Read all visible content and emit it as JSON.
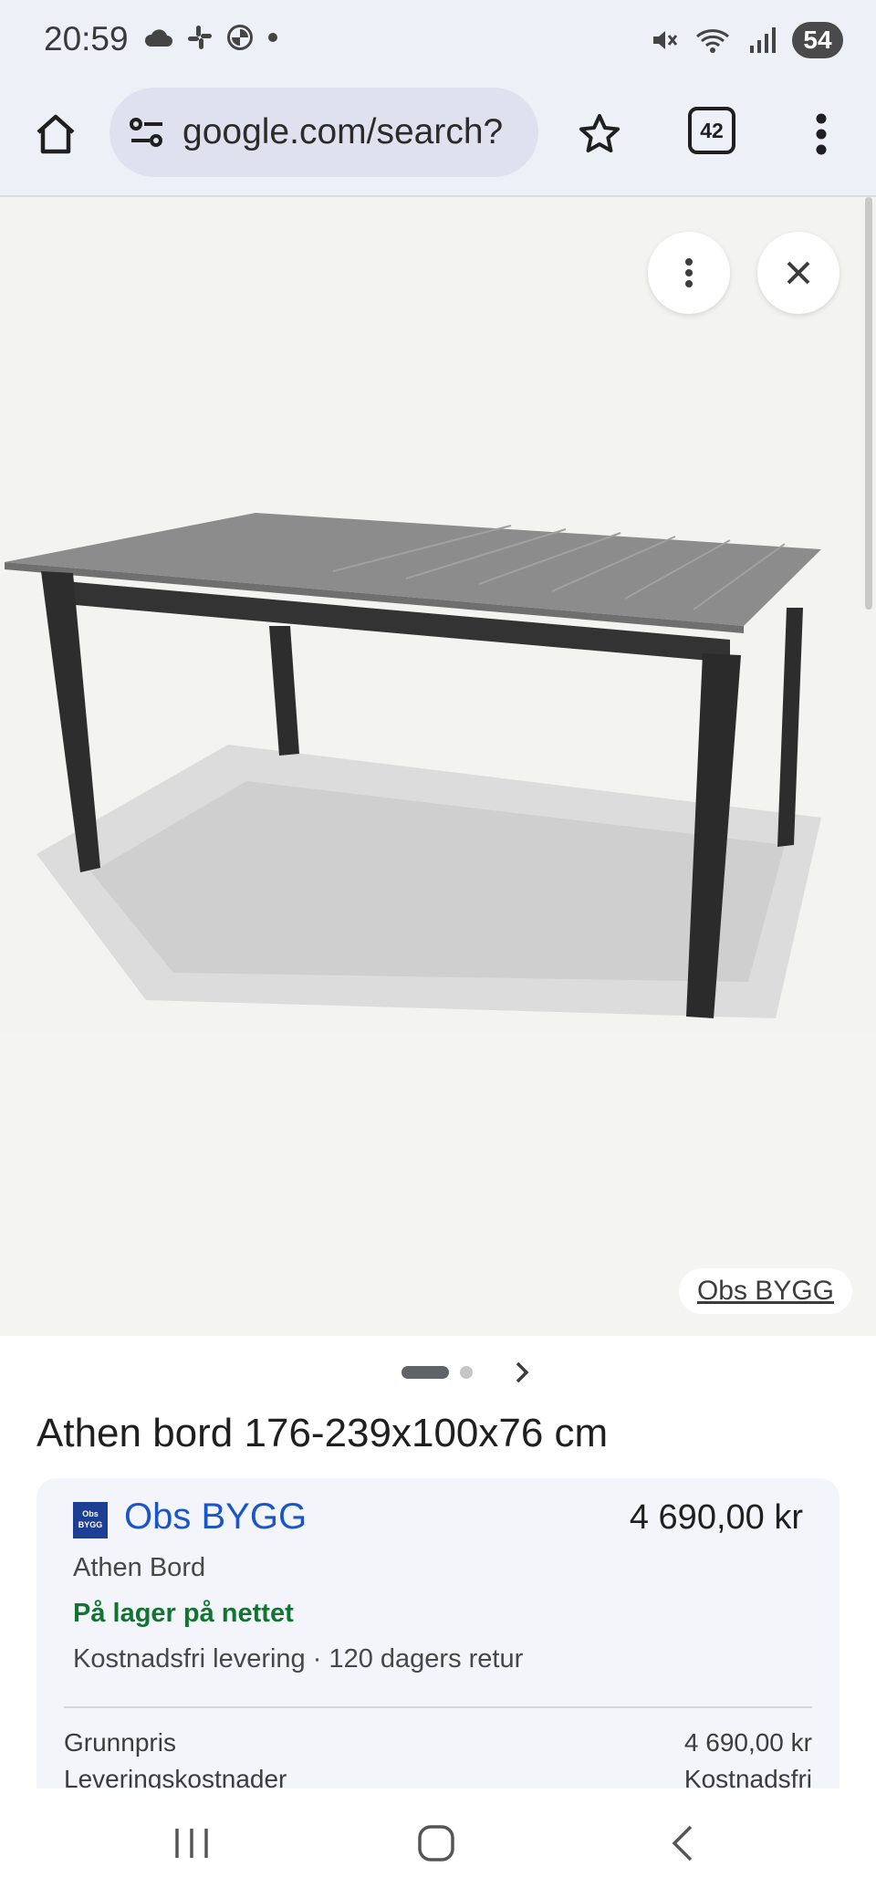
{
  "status_bar": {
    "time": "20:59",
    "battery": "54",
    "left_icons": [
      "cloud-icon",
      "slack-icon",
      "bmw-icon",
      "dot-icon"
    ],
    "right_icons": [
      "mute-icon",
      "wifi-icon",
      "signal-icon",
      "battery-icon"
    ]
  },
  "browser": {
    "url": "google.com/search?",
    "tab_count": "42",
    "icons": {
      "home": "home-icon",
      "site_settings": "tune-icon",
      "bookmark": "star-outline-icon",
      "menu": "more-vert-icon"
    }
  },
  "viewer": {
    "image_alt": "Athen bord",
    "source_label": "Obs BYGG",
    "pager": {
      "current": 1,
      "total": 2
    }
  },
  "product": {
    "title": "Athen bord 176-239x100x76 cm"
  },
  "offer": {
    "seller_logo_text": "Obs BYGG",
    "seller_name": "Obs BYGG",
    "price": "4 690,00 kr",
    "product_name": "Athen Bord",
    "stock_status": "På lager på nettet",
    "delivery_info": "Kostnadsfri levering · 120 dagers retur",
    "rows": [
      {
        "label": "Grunnpris",
        "value": "4 690,00 kr"
      },
      {
        "label": "Leveringskostnader",
        "value": "Kostnadsfri"
      }
    ]
  },
  "colors": {
    "chrome_bg": "#eef0f8",
    "link_blue": "#1a56c9",
    "stock_green": "#137333",
    "card_bg": "#f3f5fa"
  }
}
